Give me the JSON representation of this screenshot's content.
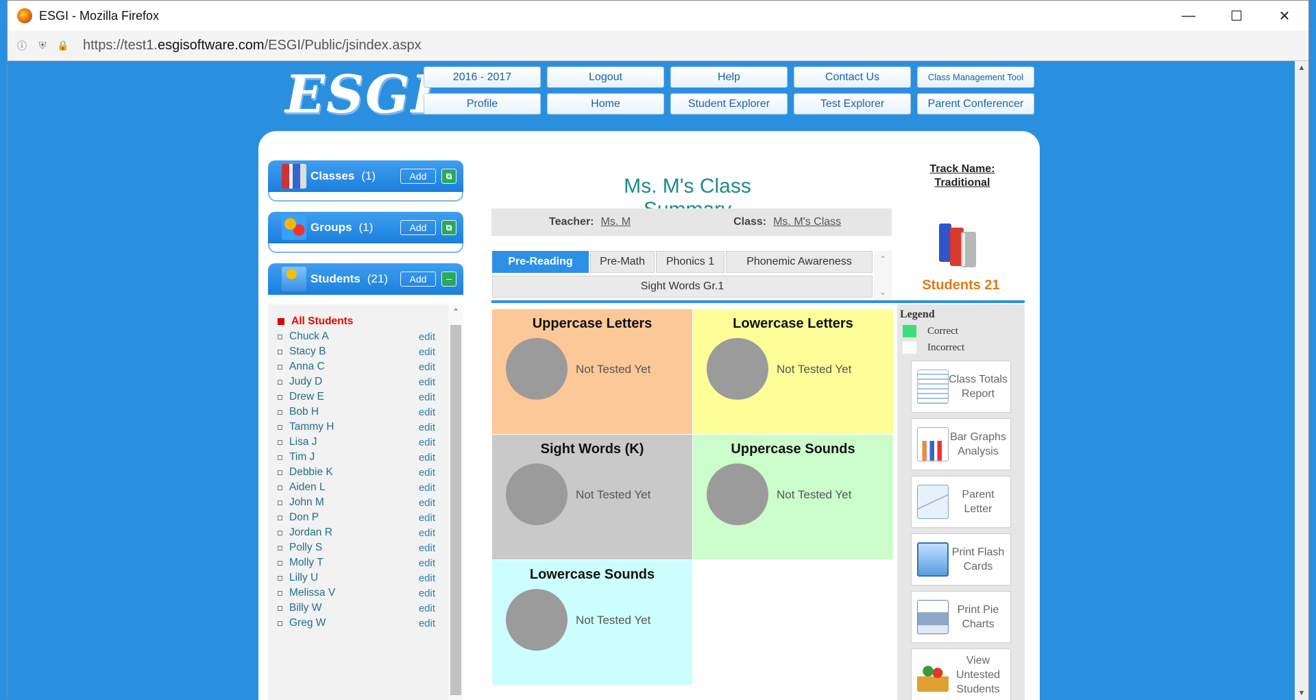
{
  "window": {
    "title": "ESGI - Mozilla Firefox",
    "url_prefix": "https://test1.",
    "url_domain": "esgisoftware.com",
    "url_path": "/ESGI/Public/jsindex.aspx"
  },
  "logo": "ESGI",
  "nav": {
    "row1": [
      "2016 - 2017",
      "Logout",
      "Help",
      "Contact Us",
      "Class Management Tool"
    ],
    "row2": [
      "Profile",
      "Home",
      "Student Explorer",
      "Test Explorer",
      "Parent Conferencer"
    ]
  },
  "sidebar": {
    "classes": {
      "label": "Classes",
      "count": "(1)",
      "add": "Add"
    },
    "groups": {
      "label": "Groups",
      "count": "(1)",
      "add": "Add"
    },
    "students": {
      "label": "Students",
      "count": "(21)",
      "add": "Add"
    },
    "all_students": "All Students",
    "edit_label": "edit",
    "student_names": [
      "Chuck A",
      "Stacy B",
      "Anna C",
      "Judy D",
      "Drew E",
      "Bob H",
      "Tammy H",
      "Lisa J",
      "Tim J",
      "Debbie K",
      "Aiden L",
      "John M",
      "Don P",
      "Jordan R",
      "Polly S",
      "Molly T",
      "Lilly U",
      "Melissa V",
      "Billy W",
      "Greg W"
    ]
  },
  "main": {
    "title": "Ms. M's Class Summary",
    "teacher_label": "Teacher:",
    "teacher": "Ms. M",
    "class_label": "Class:",
    "class": "Ms. M's Class",
    "tabs": [
      "Pre-Reading",
      "Pre-Math",
      "Phonics 1",
      "Phonemic Awareness",
      "Sight Words Gr.1"
    ],
    "active_tab": "Pre-Reading",
    "tiles": [
      {
        "title": "Uppercase Letters",
        "status": "Not Tested Yet",
        "color": "#fdc898"
      },
      {
        "title": "Lowercase Letters",
        "status": "Not Tested Yet",
        "color": "#fefe99"
      },
      {
        "title": "Sight Words (K)",
        "status": "Not Tested Yet",
        "color": "#c9c9c9"
      },
      {
        "title": "Uppercase Sounds",
        "status": "Not Tested Yet",
        "color": "#cbfecb"
      },
      {
        "title": "Lowercase Sounds",
        "status": "Not Tested Yet",
        "color": "#ccfefe"
      }
    ]
  },
  "right": {
    "track_line1": "Track Name:",
    "track_line2": "Traditional",
    "students_label": "Students 21",
    "legend_title": "Legend",
    "legend_correct": "Correct",
    "legend_incorrect": "Incorrect",
    "correct_color": "#3ce07a",
    "reports": [
      {
        "label": "Class Totals Report",
        "icon": "report-icon"
      },
      {
        "label": "Bar Graphs Analysis",
        "icon": "bar-graph-icon"
      },
      {
        "label": "Parent Letter",
        "icon": "envelope-icon"
      },
      {
        "label": "Print Flash Cards",
        "icon": "flash-cards-icon"
      },
      {
        "label": "Print Pie Charts",
        "icon": "printer-icon"
      },
      {
        "label": "View Untested Students",
        "icon": "untested-students-icon"
      }
    ]
  }
}
